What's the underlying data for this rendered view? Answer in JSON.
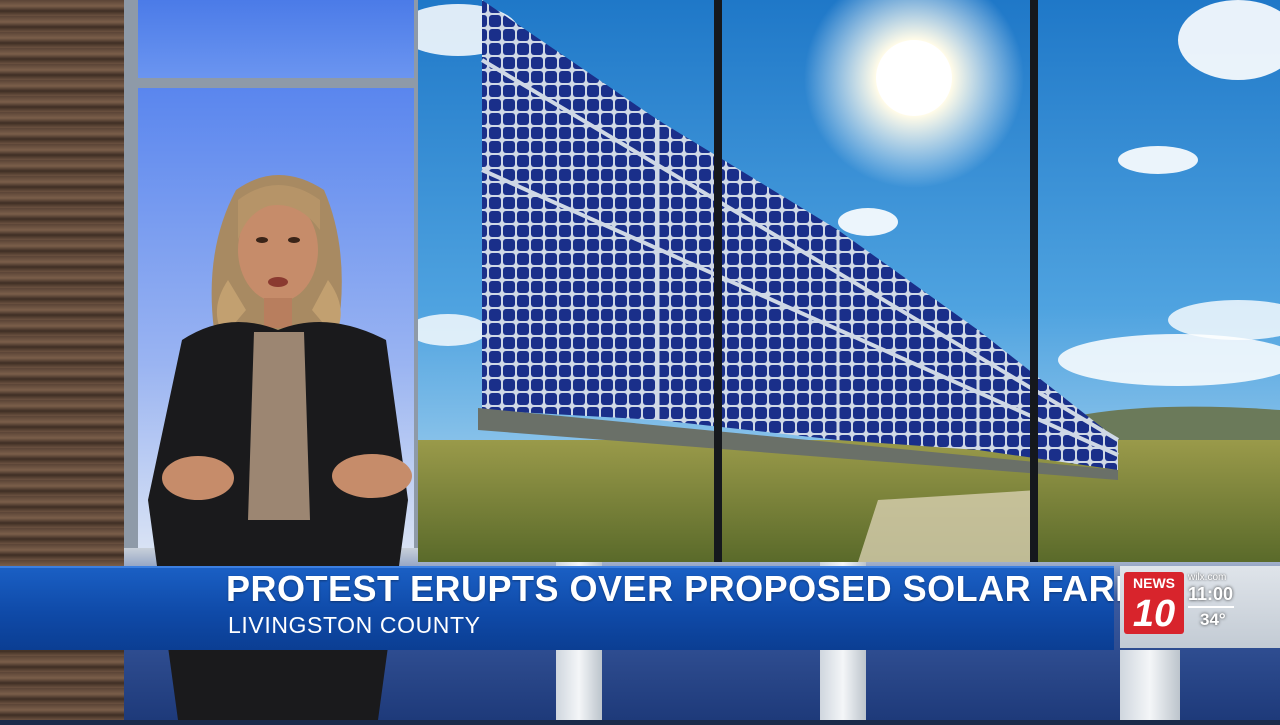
{
  "lower_third": {
    "headline": "PROTEST ERUPTS OVER PROPOSED SOLAR FARM",
    "subline": "LIVINGSTON COUNTY"
  },
  "station_bug": {
    "logo_word": "NEWS",
    "logo_number": "10",
    "website": "wilx.com",
    "time": "11:00",
    "temperature": "34°"
  },
  "colors": {
    "lower_third_blue": "#1257bd",
    "logo_red": "#d8242c",
    "sky_blue": "#2a8fd6"
  }
}
